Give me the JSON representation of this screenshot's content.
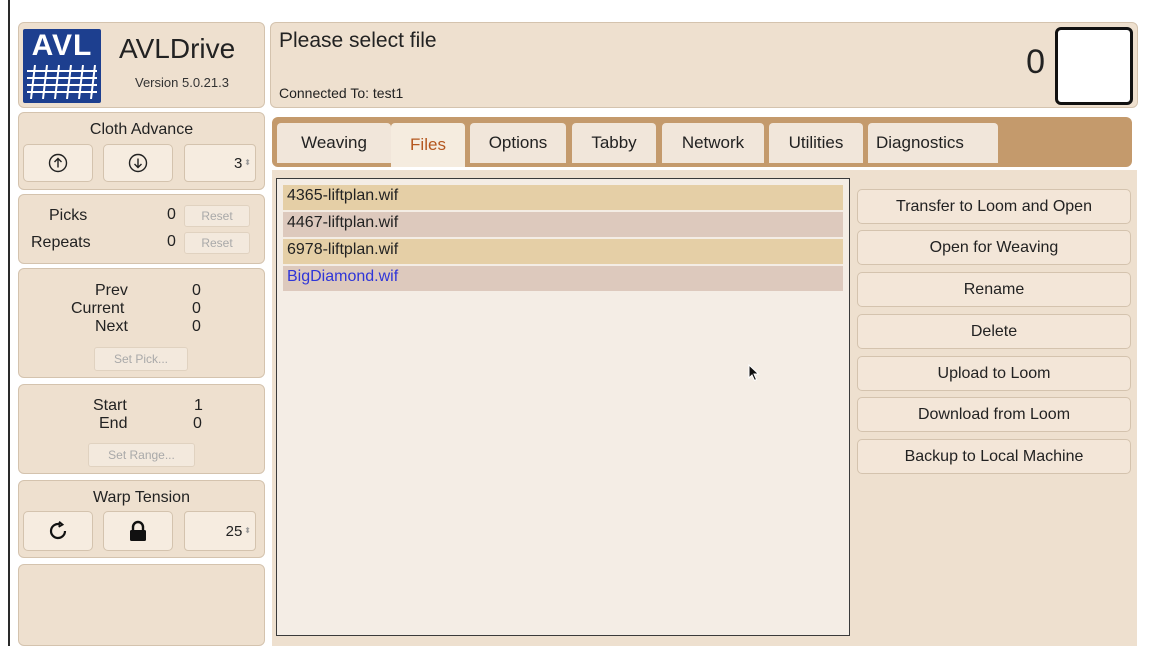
{
  "app": {
    "logo_text": "AVL",
    "title": "AVLDrive",
    "version": "Version 5.0.21.3"
  },
  "header": {
    "title": "Please select file",
    "connected": "Connected To: test1",
    "count": "0"
  },
  "cloth_advance": {
    "title": "Cloth Advance",
    "up_icon": "arrow-up-circle-icon",
    "down_icon": "arrow-down-circle-icon",
    "value": "3"
  },
  "counters": {
    "picks_label": "Picks",
    "picks_value": "0",
    "repeats_label": "Repeats",
    "repeats_value": "0",
    "reset_label": "Reset"
  },
  "picks_nav": {
    "prev_label": "Prev",
    "prev_value": "0",
    "current_label": "Current",
    "current_value": "0",
    "next_label": "Next",
    "next_value": "0",
    "set_pick_label": "Set Pick..."
  },
  "range": {
    "start_label": "Start",
    "start_value": "1",
    "end_label": "End",
    "end_value": "0",
    "set_range_label": "Set Range..."
  },
  "warp_tension": {
    "title": "Warp Tension",
    "refresh_icon": "refresh-icon",
    "lock_icon": "lock-icon",
    "value": "25"
  },
  "tabs": [
    {
      "label": "Weaving",
      "active": false
    },
    {
      "label": "Files",
      "active": true
    },
    {
      "label": "Options",
      "active": false
    },
    {
      "label": "Tabby",
      "active": false
    },
    {
      "label": "Network",
      "active": false
    },
    {
      "label": "Utilities",
      "active": false
    },
    {
      "label": "Diagnostics",
      "active": false
    }
  ],
  "files": [
    {
      "name": "4365-liftplan.wif"
    },
    {
      "name": "4467-liftplan.wif"
    },
    {
      "name": "6978-liftplan.wif"
    },
    {
      "name": "BigDiamond.wif"
    }
  ],
  "actions": [
    {
      "label": "Transfer to Loom and Open"
    },
    {
      "label": "Open for Weaving"
    },
    {
      "label": "Rename"
    },
    {
      "label": "Delete"
    },
    {
      "label": "Upload to Loom"
    },
    {
      "label": "Download from Loom"
    },
    {
      "label": "Backup to Local Machine"
    }
  ],
  "colors": {
    "panel": "#eee0cf",
    "tab_bar": "#c49a6c",
    "active_tab_text": "#b4571f",
    "file_link": "#2f35d8"
  }
}
